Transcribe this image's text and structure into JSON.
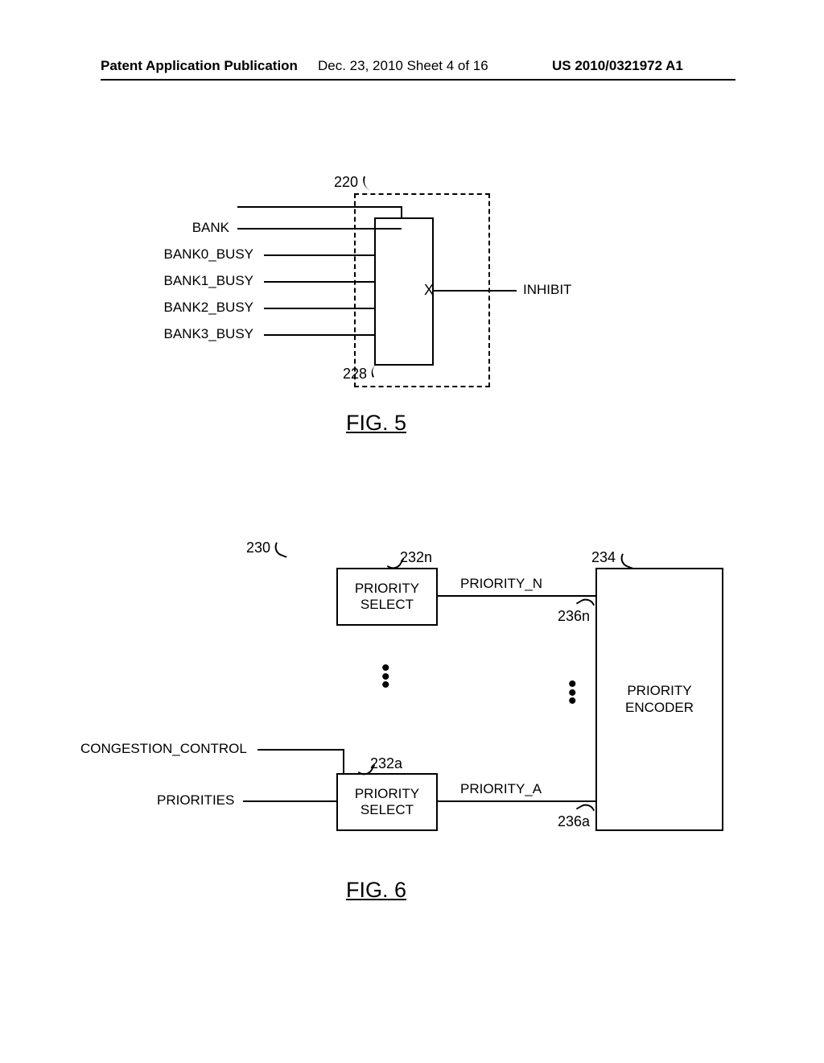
{
  "header": {
    "left": "Patent Application Publication",
    "mid": "Dec. 23, 2010  Sheet 4 of 16",
    "right": "US 2010/0321972 A1"
  },
  "fig5": {
    "title": "FIG. 5",
    "signals": {
      "bank": "BANK",
      "b0": "BANK0_BUSY",
      "b1": "BANK1_BUSY",
      "b2": "BANK2_BUSY",
      "b3": "BANK3_BUSY",
      "out": "INHIBIT",
      "mux_label": "X"
    },
    "refs": {
      "r220": "220",
      "r228": "228"
    }
  },
  "fig6": {
    "title": "FIG. 6",
    "labels": {
      "priority_select": "PRIORITY\nSELECT",
      "priority_encoder": "PRIORITY\nENCODER",
      "priority_n": "PRIORITY_N",
      "priority_a": "PRIORITY_A",
      "congestion": "CONGESTION_CONTROL",
      "priorities": "PRIORITIES"
    },
    "refs": {
      "r230": "230",
      "r232n": "232n",
      "r232a": "232a",
      "r234": "234",
      "r236n": "236n",
      "r236a": "236a"
    }
  },
  "chart_data": {
    "type": "diagram",
    "figures": [
      {
        "id": "FIG. 5",
        "component": "Multiplexer block (220)",
        "inputs": [
          "BANK (select)",
          "BANK0_BUSY",
          "BANK1_BUSY",
          "BANK2_BUSY",
          "BANK3_BUSY"
        ],
        "outputs": [
          "INHIBIT"
        ],
        "internal_label": "X (228)"
      },
      {
        "id": "FIG. 6",
        "component": "Priority encoding block (230)",
        "blocks": [
          {
            "id": "232n",
            "name": "PRIORITY SELECT",
            "output": "PRIORITY_N (236n)"
          },
          {
            "id": "...",
            "name": "(repeated PRIORITY SELECT blocks)"
          },
          {
            "id": "232a",
            "name": "PRIORITY SELECT",
            "output": "PRIORITY_A (236a)"
          },
          {
            "id": "234",
            "name": "PRIORITY ENCODER"
          }
        ],
        "inputs": [
          "CONGESTION_CONTROL",
          "PRIORITIES"
        ],
        "outputs_feed_into": "PRIORITY ENCODER (234)"
      }
    ]
  }
}
